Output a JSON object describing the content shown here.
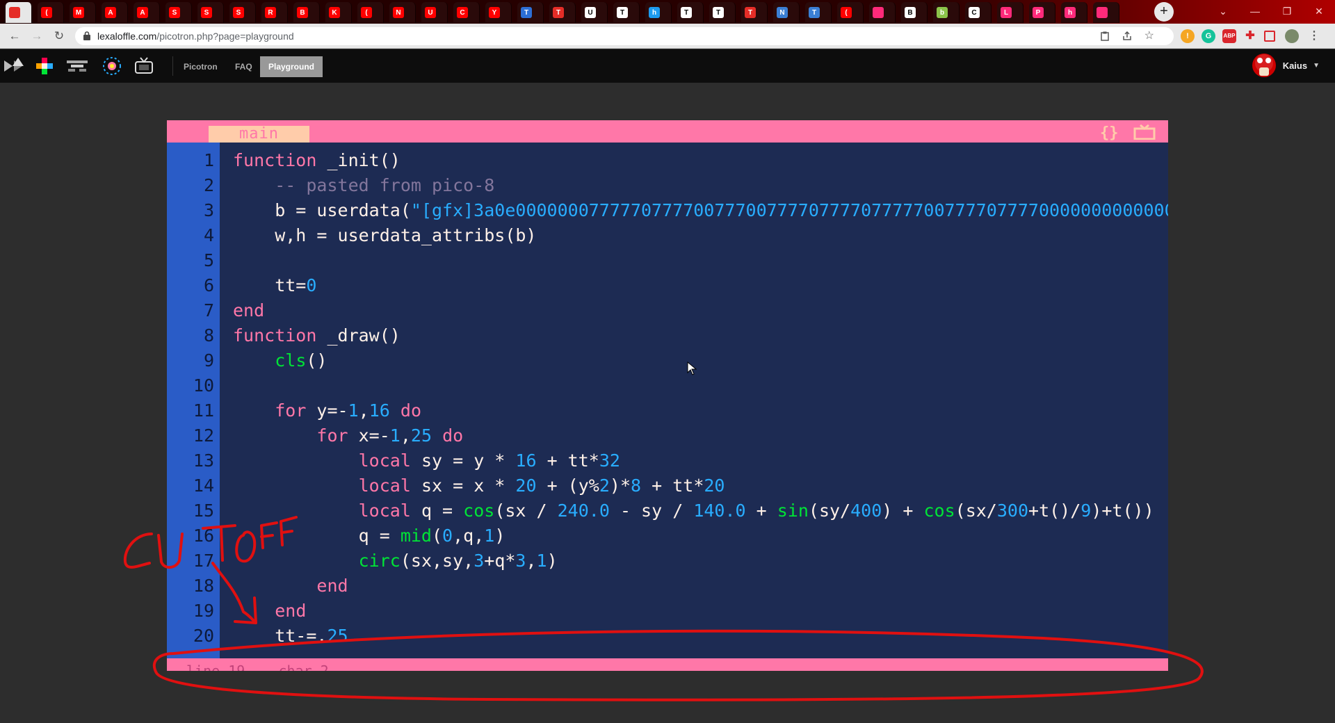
{
  "browser": {
    "tabs": [
      {
        "letter": "",
        "color": "#e52d27"
      },
      {
        "letter": "(",
        "color": "#ff0000"
      },
      {
        "letter": "M",
        "color": "#ff0000"
      },
      {
        "letter": "A",
        "color": "#ff0000"
      },
      {
        "letter": "A",
        "color": "#ff0000"
      },
      {
        "letter": "S",
        "color": "#ff0000"
      },
      {
        "letter": "S",
        "color": "#ff0000"
      },
      {
        "letter": "S",
        "color": "#ff0000"
      },
      {
        "letter": "R",
        "color": "#ff0000"
      },
      {
        "letter": "B",
        "color": "#ff0000"
      },
      {
        "letter": "K",
        "color": "#ff0000"
      },
      {
        "letter": "(",
        "color": "#ff0000"
      },
      {
        "letter": "N",
        "color": "#ff0000"
      },
      {
        "letter": "U",
        "color": "#ff0000"
      },
      {
        "letter": "C",
        "color": "#ff0000"
      },
      {
        "letter": "Y",
        "color": "#ff0000"
      },
      {
        "letter": "T",
        "color": "#2d6fd6"
      },
      {
        "letter": "T",
        "color": "#e52d27"
      },
      {
        "letter": "U",
        "color": "#ffffff"
      },
      {
        "letter": "T",
        "color": "#ffffff"
      },
      {
        "letter": "h",
        "color": "#1d9bf0"
      },
      {
        "letter": "T",
        "color": "#ffffff"
      },
      {
        "letter": "T",
        "color": "#ffffff"
      },
      {
        "letter": "T",
        "color": "#e52d27"
      },
      {
        "letter": "N",
        "color": "#3b7fd4"
      },
      {
        "letter": "T",
        "color": "#3b7fd4"
      },
      {
        "letter": "(",
        "color": "#ff0000"
      },
      {
        "letter": "",
        "color": "#ff2a7a"
      },
      {
        "letter": "B",
        "color": "#ffffff"
      },
      {
        "letter": "b",
        "color": "#8bc34a"
      },
      {
        "letter": "C",
        "color": "#ffffff"
      },
      {
        "letter": "L",
        "color": "#ff2a7a"
      },
      {
        "letter": "P",
        "color": "#ff2a7a"
      },
      {
        "letter": "h",
        "color": "#ff2a7a"
      },
      {
        "letter": "",
        "color": "#ff2a7a"
      }
    ],
    "new_tab": "+",
    "window_controls": {
      "dropdown": "⌄",
      "minimize": "—",
      "restore": "❐",
      "close": "✕"
    },
    "url_domain": "lexaloffle.com",
    "url_path": "/picotron.php?page=playground"
  },
  "site": {
    "nav": [
      {
        "label": "Picotron",
        "active": false
      },
      {
        "label": "FAQ",
        "active": false
      },
      {
        "label": "Playground",
        "active": true
      }
    ],
    "username": "Kaius",
    "caret": "▼"
  },
  "editor": {
    "tab_label": "main",
    "icon_code": "{}",
    "icon_run": "▭",
    "line_numbers": [
      "1",
      "2",
      "3",
      "4",
      "5",
      "6",
      "7",
      "8",
      "9",
      "10",
      "11",
      "12",
      "13",
      "14",
      "15",
      "16",
      "17",
      "18",
      "19",
      "20"
    ],
    "lines": [
      "function _init()",
      "    -- pasted from pico-8",
      "    b = userdata(\"[gfx]3a0e000000077777077770077700777707777077777007777077770000000000000",
      "    w,h = userdata_attribs(b)",
      "",
      "    tt=0",
      "end",
      "function _draw()",
      "    cls()",
      "",
      "    for y=-1,16 do",
      "        for x=-1,25 do",
      "            local sy = y * 16 + tt*32",
      "            local sx = x * 20 + (y%2)*8 + tt*20",
      "            local q = cos(sx / 240.0 - sy / 140.0 + sin(sy/400) + cos(sx/300+t()/9)+t())",
      "            q = mid(0,q,1)",
      "            circ(sx,sy,3+q*3,1)",
      "        end",
      "    end",
      "    tt-=.25"
    ],
    "status": "line 19    char 2"
  },
  "annotation": {
    "text": "CUTOFF",
    "color": "#e01010"
  }
}
